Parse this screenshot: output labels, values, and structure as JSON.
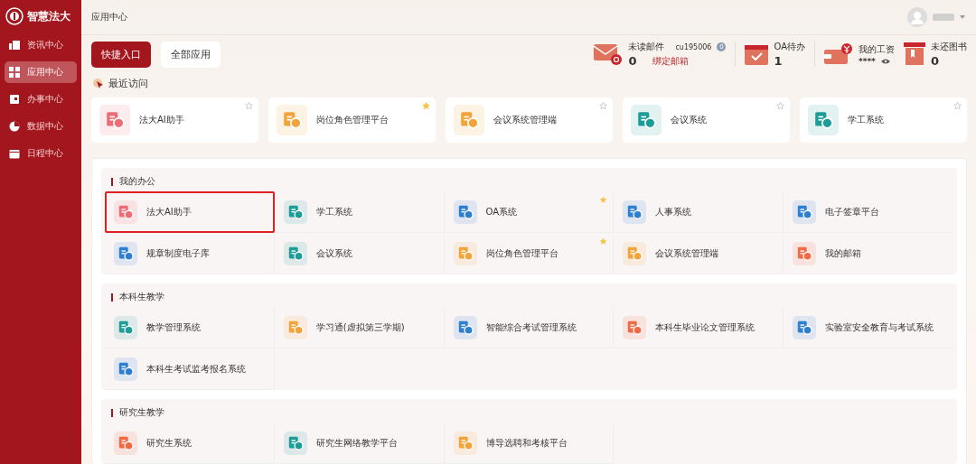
{
  "sidebar": {
    "logo": "智慧法大",
    "items": [
      {
        "kind": "news",
        "label": "资讯中心",
        "selected": false
      },
      {
        "kind": "apps",
        "label": "应用中心",
        "selected": true
      },
      {
        "kind": "affairs",
        "label": "办事中心",
        "selected": false
      },
      {
        "kind": "data",
        "label": "数据中心",
        "selected": false
      },
      {
        "kind": "schedule",
        "label": "日程中心",
        "selected": false
      }
    ]
  },
  "header": {
    "breadcrumb": "应用中心"
  },
  "tabs": [
    {
      "label": "快捷入口",
      "selected": true
    },
    {
      "label": "全部应用",
      "selected": false
    }
  ],
  "stats": [
    {
      "kind": "mail",
      "label": "未读邮件",
      "value": "0",
      "account": "cu195006",
      "account_badge": "0",
      "link": "绑定邮箱"
    },
    {
      "kind": "todo",
      "label": "OA待办",
      "value": "1"
    },
    {
      "kind": "salary",
      "label": "我的工资",
      "value": "****"
    },
    {
      "kind": "books",
      "label": "未还图书",
      "value": "0"
    }
  ],
  "recent": {
    "title": "最近访问",
    "items": [
      {
        "name": "法大AI助手",
        "color": "#ec6d76",
        "starred": false
      },
      {
        "name": "岗位角色管理平台",
        "color": "#f2a33a",
        "starred": true
      },
      {
        "name": "会议系统管理端",
        "color": "#f2a33a",
        "starred": false
      },
      {
        "name": "会议系统",
        "color": "#1e9c98",
        "starred": false
      },
      {
        "name": "学工系统",
        "color": "#1e9c98",
        "starred": false
      }
    ]
  },
  "sections": [
    {
      "title": "我的办公",
      "apps": [
        {
          "name": "法大AI助手",
          "color": "#ec6d76",
          "starred": false,
          "highlighted": true
        },
        {
          "name": "学工系统",
          "color": "#1e9c98",
          "starred": false,
          "highlighted": false
        },
        {
          "name": "OA系统",
          "color": "#2f7fd0",
          "starred": true,
          "highlighted": false
        },
        {
          "name": "人事系统",
          "color": "#2f7fd0",
          "starred": false,
          "highlighted": false
        },
        {
          "name": "电子签章平台",
          "color": "#2f7fd0",
          "starred": false,
          "highlighted": false
        },
        {
          "name": "规章制度电子库",
          "color": "#2f7fd0",
          "starred": false,
          "highlighted": false
        },
        {
          "name": "会议系统",
          "color": "#1e9c98",
          "starred": false,
          "highlighted": false
        },
        {
          "name": "岗位角色管理平台",
          "color": "#f2a33a",
          "starred": true,
          "highlighted": false
        },
        {
          "name": "会议系统管理端",
          "color": "#f2a33a",
          "starred": false,
          "highlighted": false
        },
        {
          "name": "我的邮箱",
          "color": "#ef6a45",
          "starred": false,
          "highlighted": false
        }
      ]
    },
    {
      "title": "本科生教学",
      "apps": [
        {
          "name": "教学管理系统",
          "color": "#1e9c98",
          "starred": false,
          "highlighted": false
        },
        {
          "name": "学习通(虚拟第三学期)",
          "color": "#f2a33a",
          "starred": false,
          "highlighted": false
        },
        {
          "name": "智能综合考试管理系统",
          "color": "#2f7fd0",
          "starred": false,
          "highlighted": false
        },
        {
          "name": "本科生毕业论文管理系统",
          "color": "#ef6a45",
          "starred": false,
          "highlighted": false
        },
        {
          "name": "实验室安全教育与考试系统",
          "color": "#2f7fd0",
          "starred": false,
          "highlighted": false
        },
        {
          "name": "本科生考试监考报名系统",
          "color": "#2f7fd0",
          "starred": false,
          "highlighted": false
        }
      ]
    },
    {
      "title": "研究生教学",
      "apps": [
        {
          "name": "研究生系统",
          "color": "#ef6a45",
          "starred": false,
          "highlighted": false
        },
        {
          "name": "研究生网络教学平台",
          "color": "#1e9c98",
          "starred": false,
          "highlighted": false
        },
        {
          "name": "博导选聘和考核平台",
          "color": "#f2a33a",
          "starred": false,
          "highlighted": false
        }
      ]
    }
  ]
}
